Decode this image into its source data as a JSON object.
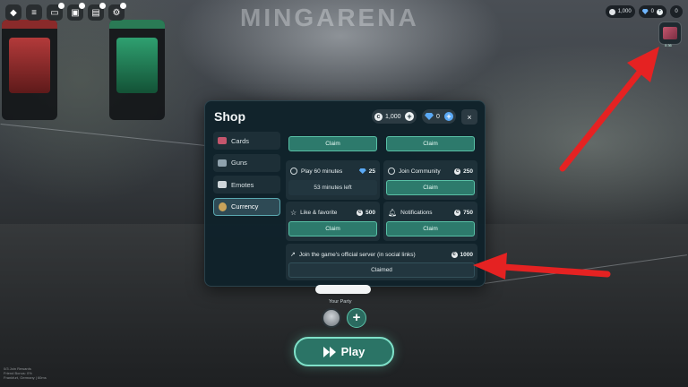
{
  "scene": {
    "arena_text": "MINGARENA"
  },
  "topbar": {
    "right": {
      "coins": "1,000",
      "gems": "0",
      "extra": "0",
      "reward_timer": "0:36"
    }
  },
  "shop": {
    "title": "Shop",
    "coins": "1,000",
    "gems": "0",
    "close": "×",
    "categories": [
      {
        "label": "Cards",
        "icon": "cards-icon",
        "color": "#c4566d"
      },
      {
        "label": "Guns",
        "icon": "gun-icon",
        "color": "#8fa2ad"
      },
      {
        "label": "Emotes",
        "icon": "emote-icon",
        "color": "#cfd6da"
      },
      {
        "label": "Currency",
        "icon": "money-bag-icon",
        "color": "#c9a35a"
      }
    ],
    "tasks": [
      {
        "label": "",
        "button": "Claim"
      },
      {
        "label": "",
        "button": "Claim"
      },
      {
        "label": "Play 60 minutes",
        "reward": "25",
        "reward_type": "gem",
        "status": "53 minutes left"
      },
      {
        "label": "Join Community",
        "reward": "250",
        "reward_type": "coin",
        "button": "Claim"
      },
      {
        "label": "Like & favorite",
        "reward": "500",
        "reward_type": "coin",
        "button": "Claim"
      },
      {
        "label": "Notifications",
        "reward": "750",
        "reward_type": "coin",
        "button": "Claim"
      },
      {
        "label": "Join the game's official server (in social links)",
        "reward": "1000",
        "reward_type": "coin",
        "button": "Claimed"
      }
    ]
  },
  "party": {
    "label": "Your Party",
    "add": "+"
  },
  "play_button": "Play",
  "footer": {
    "line1": "0/3 Join Rewards",
    "line2": "Friend Bonus: 0%",
    "line3": "Frankfurt, Germany | 60ms"
  },
  "colors": {
    "accent": "#2d7a6c",
    "arrow": "#e52222"
  }
}
